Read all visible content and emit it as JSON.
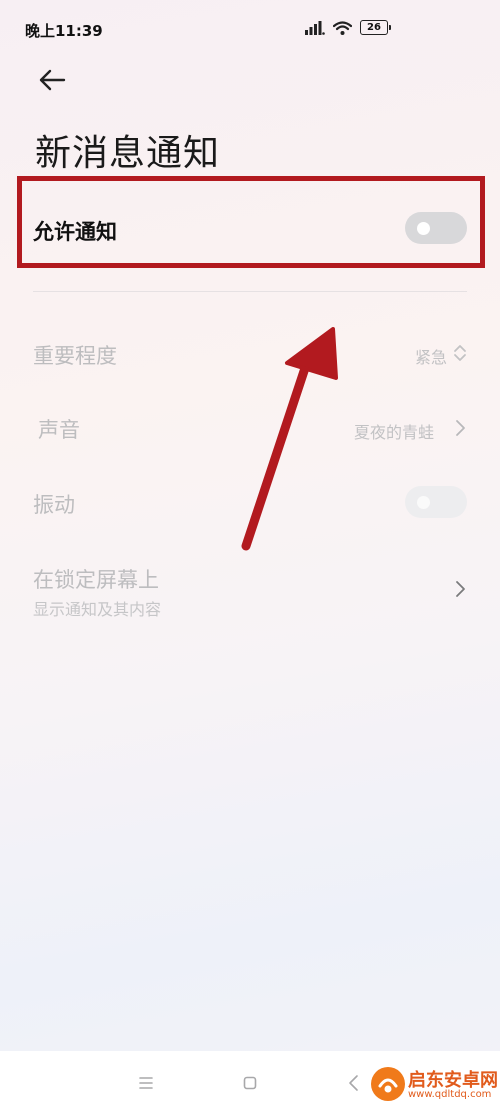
{
  "status_bar": {
    "time": "晚上11:39",
    "battery": "26"
  },
  "header": {
    "title": "新消息通知"
  },
  "allow_notifications": {
    "label": "允许通知",
    "enabled": false
  },
  "settings": {
    "importance": {
      "label": "重要程度",
      "value": "紧急"
    },
    "sound": {
      "label": "声音",
      "value": "夏夜的青蛙"
    },
    "vibration": {
      "label": "振动",
      "enabled": false
    },
    "lock_screen": {
      "label": "在锁定屏幕上",
      "sublabel": "显示通知及其内容"
    }
  },
  "annotation": {
    "box_color": "#b21a1f",
    "arrow_color": "#b21a1f"
  },
  "watermark": {
    "name": "启东安卓网",
    "url": "www.qdltdq.com"
  }
}
